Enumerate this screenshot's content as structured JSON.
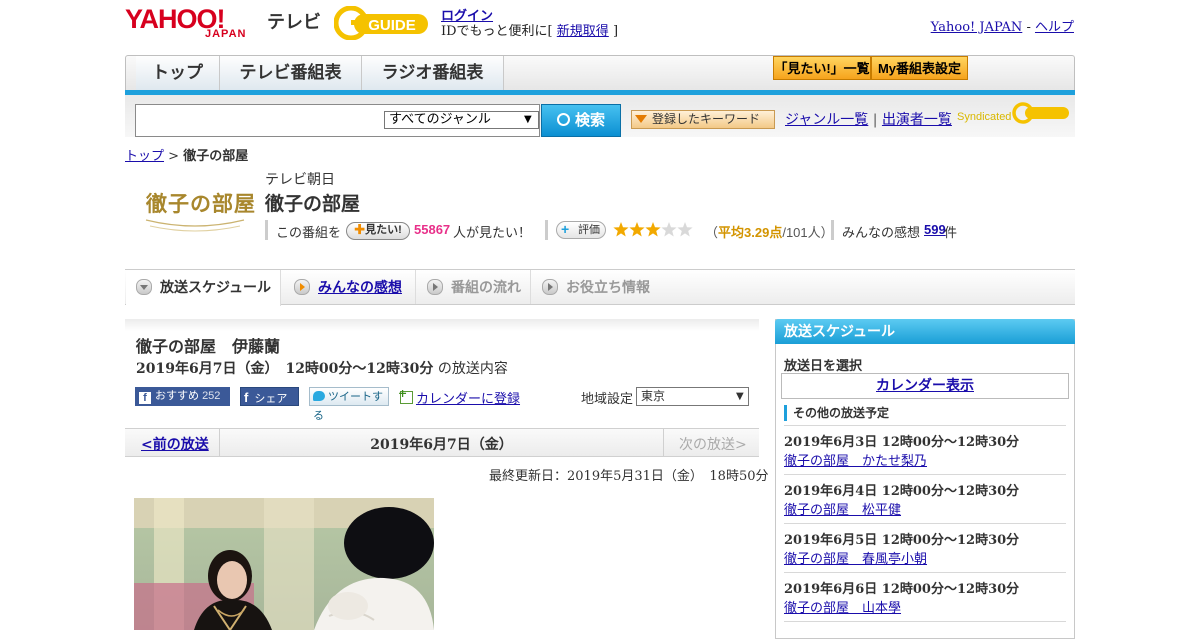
{
  "header": {
    "logo_yahoo": "YAHOO!",
    "logo_japan": "JAPAN",
    "logo_tv": "テレビ",
    "logo_gguide": "GUIDE",
    "login_label": "ログイン",
    "login_prefix": "IDでもっと便利に[",
    "register_label": "新規取得",
    "login_suffix": "]",
    "yahoo_japan_label": "Yahoo! JAPAN",
    "sep": "-",
    "help_label": "ヘルプ"
  },
  "nav": {
    "tabs": [
      {
        "label": "トップ"
      },
      {
        "label": "テレビ番組表"
      },
      {
        "label": "ラジオ番組表"
      }
    ],
    "mitai_list_label": "「見たい!」一覧",
    "my_schedule_label": "My番組表設定"
  },
  "search": {
    "placeholder": "",
    "genre_value": "すべてのジャンル",
    "search_label": "検索",
    "keyword_label": "登録したキーワード",
    "genre_list_label": "ジャンル一覧",
    "divider": "|",
    "performer_list_label": "出演者一覧",
    "syndicated_label": "Syndicated"
  },
  "breadcrumb": {
    "top_label": "トップ",
    "sep": ">",
    "current": "徹子の部屋"
  },
  "program": {
    "logo_text": "徹子の部屋",
    "station": "テレビ朝日",
    "title": "徹子の部屋",
    "this_program": "この番組を",
    "mitai_btn": "見たい!",
    "mitai_count": "55867",
    "mitai_suffix": "人が見たい！",
    "rating_btn": "評価",
    "rating_value": 3.29,
    "rating_open": "（",
    "rating_label": "平均3.29点",
    "rating_count": "/101人）",
    "impressions_label": "みんなの感想",
    "impressions_count": "599",
    "impressions_suffix": "件"
  },
  "tabs": [
    {
      "label": "放送スケジュール"
    },
    {
      "label": "みんなの感想"
    },
    {
      "label": "番組の流れ"
    },
    {
      "label": "お役立ち情報"
    }
  ],
  "episode": {
    "title": "徹子の部屋　伊藤蘭",
    "datetime": "2019年6月7日（金）　12時00分～12時30分",
    "datetime_suffix": "の放送内容",
    "fb_recommend": "おすすめ",
    "fb_count": "252",
    "fb_share": "シェア",
    "tweet": "ツイートする",
    "calendar_link": "カレンダーに登録",
    "region_label": "地域設定",
    "region_value": "東京",
    "prev_label": "<前の放送",
    "current_date": "2019年6月7日（金）",
    "next_label": "次の放送>",
    "updated": "最終更新日：2019年5月31日（金）　18時50分"
  },
  "sidebar": {
    "title": "放送スケジュール",
    "select_label": "放送日を選択",
    "calendar_label": "カレンダー表示",
    "other_label": "その他の放送予定",
    "items": [
      {
        "date": "2019年6月3日  12時00分～12時30分",
        "title": "徹子の部屋　かたせ梨乃"
      },
      {
        "date": "2019年6月4日  12時00分～12時30分",
        "title": "徹子の部屋　松平健"
      },
      {
        "date": "2019年6月5日  12時00分～12時30分",
        "title": "徹子の部屋　春風亭小朝"
      },
      {
        "date": "2019年6月6日  12時00分～12時30分",
        "title": "徹子の部屋　山本學"
      }
    ]
  },
  "colors": {
    "accent_blue": "#1ea0dc",
    "yahoo_red": "#d7001e",
    "orange": "#f6a31c",
    "link": "#1a0dab",
    "pink_count": "#e8308a"
  }
}
